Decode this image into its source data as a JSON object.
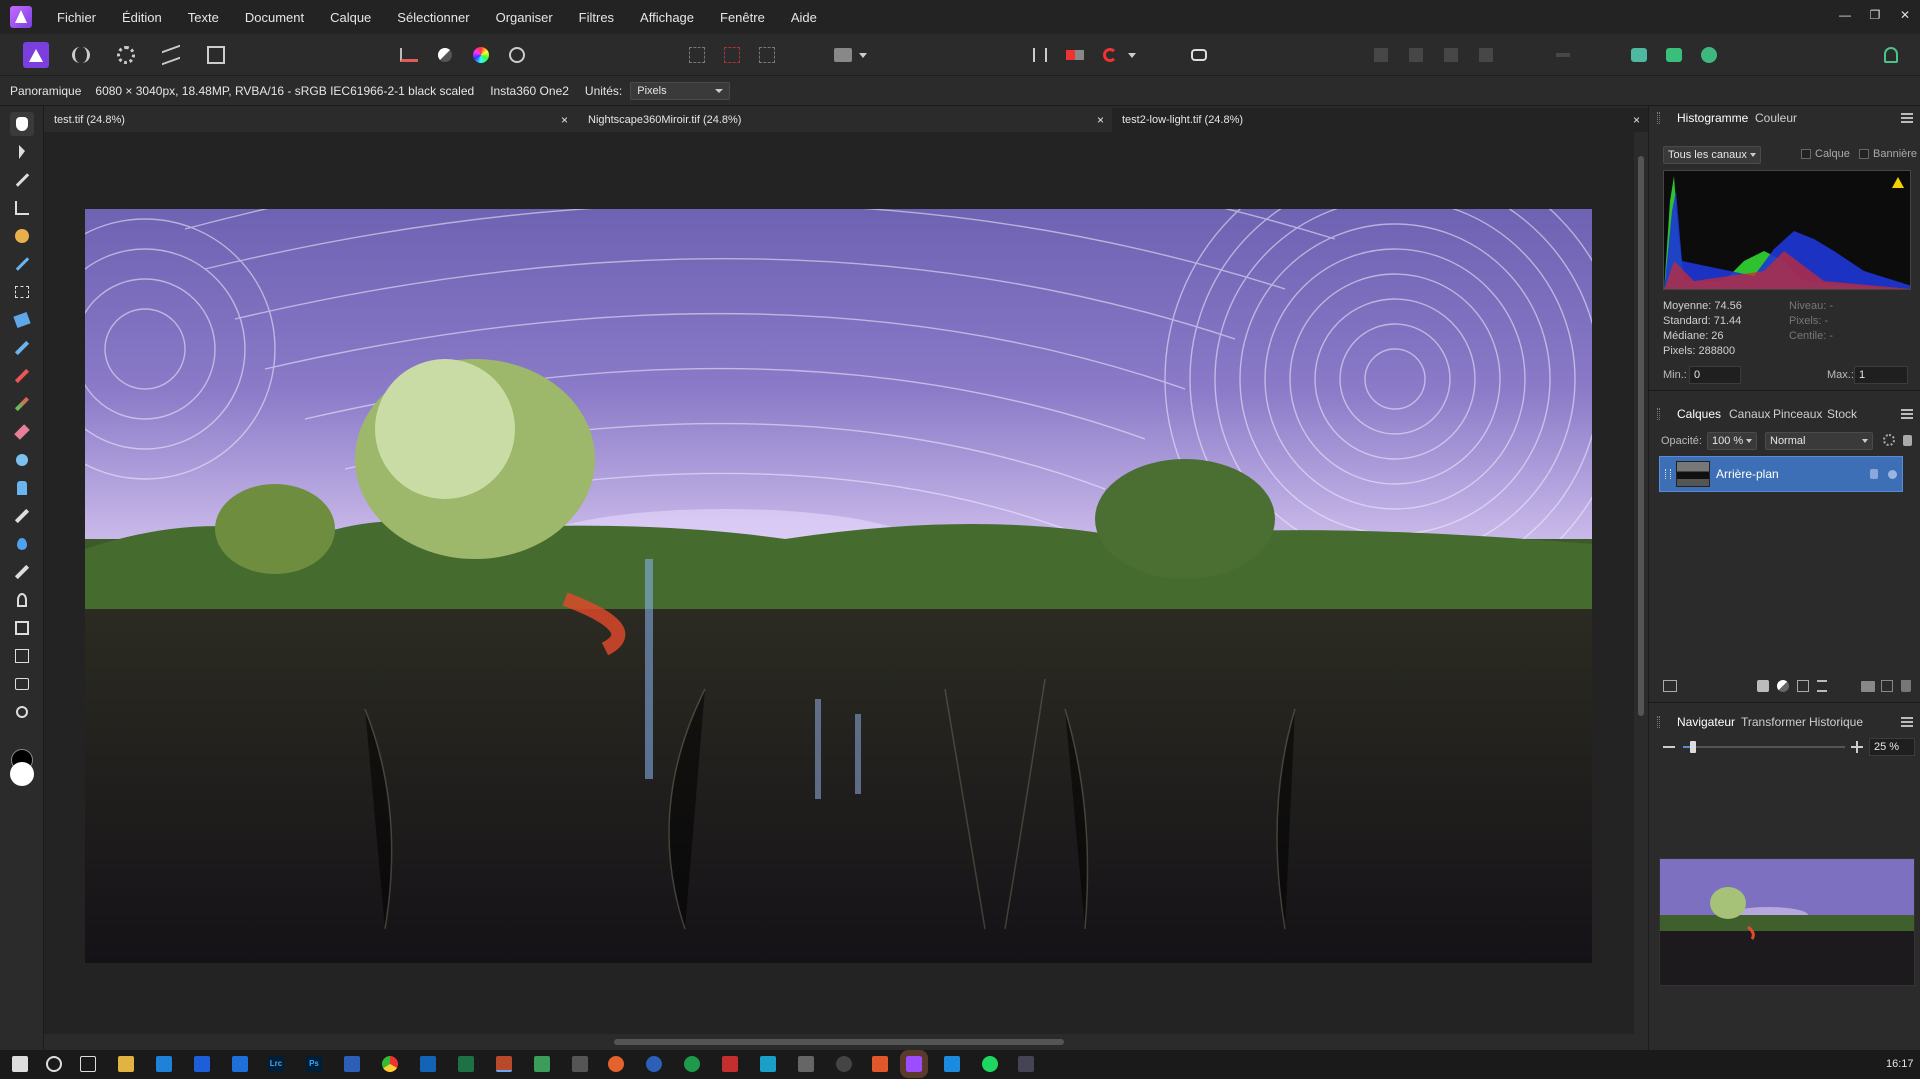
{
  "app": {
    "menus": [
      "Fichier",
      "Édition",
      "Texte",
      "Document",
      "Calque",
      "Sélectionner",
      "Organiser",
      "Filtres",
      "Affichage",
      "Fenêtre",
      "Aide"
    ],
    "window_buttons": [
      "—",
      "❐",
      "✕"
    ]
  },
  "context_bar": {
    "tool_name": "Panoramique",
    "doc_info": "6080 × 3040px, 18.48MP, RVBA/16 - sRGB IEC61966-2-1 black scaled",
    "camera": "Insta360 One2",
    "units_label": "Unités:",
    "units_value": "Pixels"
  },
  "tabs": [
    {
      "label": "test.tif (24.8%)"
    },
    {
      "label": "Nightscape360Miroir.tif (24.8%)"
    },
    {
      "label": "test2-low-light.tif (24.8%)"
    }
  ],
  "close_glyph": "×",
  "histogram_panel": {
    "tabs": [
      "Histogramme",
      "Couleur"
    ],
    "channels": "Tous les canaux",
    "layer_check": "Calque",
    "banner_check": "Bannière",
    "stats_left": [
      "Moyenne: 74.56",
      "Standard: 71.44",
      "Médiane: 26",
      "Pixels: 288800"
    ],
    "stats_right": [
      "Niveau: -",
      "Pixels: -",
      "Centile: -"
    ],
    "min_label": "Min.:",
    "min_value": "0",
    "max_label": "Max.:",
    "max_value": "1"
  },
  "layers_panel": {
    "tabs": [
      "Calques",
      "Canaux",
      "Pinceaux",
      "Stock"
    ],
    "opacity_label": "Opacité:",
    "opacity_value": "100 %",
    "blend_mode": "Normal",
    "layer_name": "Arrière-plan"
  },
  "navigator_panel": {
    "tabs": [
      "Navigateur",
      "Transformer",
      "Historique"
    ],
    "zoom_value": "25 %",
    "zoom_fraction": 0.06
  },
  "taskbar": {
    "time": "16:17",
    "labels": {
      "lrc": "Lrc",
      "ps": "Ps"
    }
  },
  "colors": {
    "accent": "#5a8ad8",
    "selected_layer": "#3d6fb6",
    "app_purple": "#9b4dff"
  }
}
